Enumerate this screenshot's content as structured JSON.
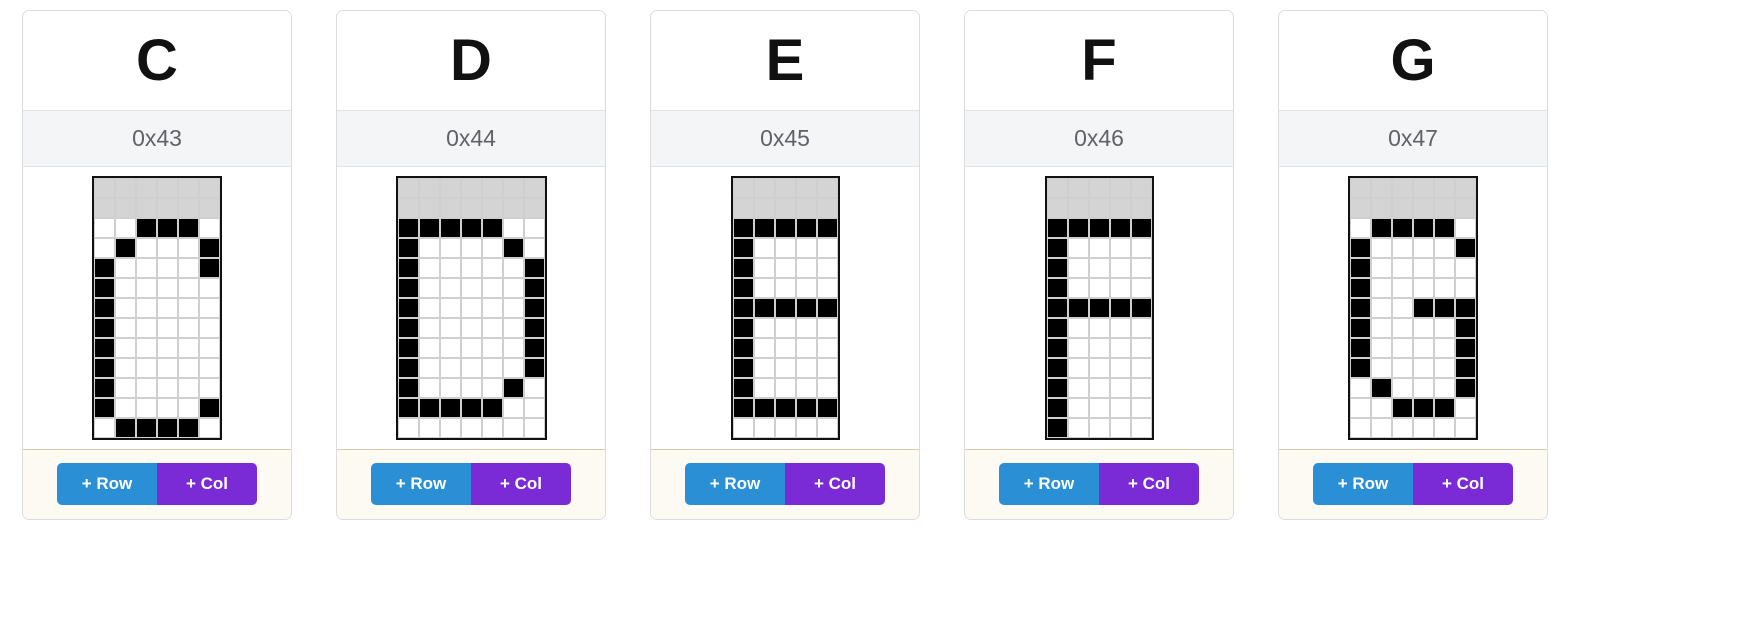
{
  "app": {
    "background": "#ffffff",
    "card_border": "#dcdcdc",
    "code_bar_bg": "#f4f5f7",
    "actions_bg": "#fdfaf3",
    "actions_border": "#dcc9a8",
    "pixel_on_color": "#000000",
    "pixel_off_color": "#ffffff",
    "pixel_ascender_color": "#d4d4d4",
    "grid_border_color": "#111111",
    "add_row_color": "#2b8fd6",
    "add_col_color": "#7a2bd6"
  },
  "buttons": {
    "add_row_label": "+ Row",
    "add_col_label": "+ Col"
  },
  "cards": [
    {
      "char": "C",
      "code": "0x43",
      "cols": 6,
      "rows": 13,
      "ascender_rows": 2,
      "pixels": [
        [
          0,
          0,
          0,
          0,
          0,
          0
        ],
        [
          0,
          0,
          0,
          0,
          0,
          0
        ],
        [
          0,
          0,
          1,
          1,
          1,
          0
        ],
        [
          0,
          1,
          0,
          0,
          0,
          1
        ],
        [
          1,
          0,
          0,
          0,
          0,
          1
        ],
        [
          1,
          0,
          0,
          0,
          0,
          0
        ],
        [
          1,
          0,
          0,
          0,
          0,
          0
        ],
        [
          1,
          0,
          0,
          0,
          0,
          0
        ],
        [
          1,
          0,
          0,
          0,
          0,
          0
        ],
        [
          1,
          0,
          0,
          0,
          0,
          0
        ],
        [
          1,
          0,
          0,
          0,
          0,
          0
        ],
        [
          1,
          0,
          0,
          0,
          0,
          1
        ],
        [
          0,
          1,
          1,
          1,
          1,
          0
        ]
      ]
    },
    {
      "char": "D",
      "code": "0x44",
      "cols": 7,
      "rows": 13,
      "ascender_rows": 2,
      "pixels": [
        [
          0,
          0,
          0,
          0,
          0,
          0,
          0
        ],
        [
          0,
          0,
          0,
          0,
          0,
          0,
          0
        ],
        [
          1,
          1,
          1,
          1,
          1,
          0,
          0
        ],
        [
          1,
          0,
          0,
          0,
          0,
          1,
          0
        ],
        [
          1,
          0,
          0,
          0,
          0,
          0,
          1
        ],
        [
          1,
          0,
          0,
          0,
          0,
          0,
          1
        ],
        [
          1,
          0,
          0,
          0,
          0,
          0,
          1
        ],
        [
          1,
          0,
          0,
          0,
          0,
          0,
          1
        ],
        [
          1,
          0,
          0,
          0,
          0,
          0,
          1
        ],
        [
          1,
          0,
          0,
          0,
          0,
          0,
          1
        ],
        [
          1,
          0,
          0,
          0,
          0,
          1,
          0
        ],
        [
          1,
          1,
          1,
          1,
          1,
          0,
          0
        ],
        [
          0,
          0,
          0,
          0,
          0,
          0,
          0
        ]
      ]
    },
    {
      "char": "E",
      "code": "0x45",
      "cols": 5,
      "rows": 13,
      "ascender_rows": 2,
      "pixels": [
        [
          0,
          0,
          0,
          0,
          0
        ],
        [
          0,
          0,
          0,
          0,
          0
        ],
        [
          1,
          1,
          1,
          1,
          1
        ],
        [
          1,
          0,
          0,
          0,
          0
        ],
        [
          1,
          0,
          0,
          0,
          0
        ],
        [
          1,
          0,
          0,
          0,
          0
        ],
        [
          1,
          1,
          1,
          1,
          1
        ],
        [
          1,
          0,
          0,
          0,
          0
        ],
        [
          1,
          0,
          0,
          0,
          0
        ],
        [
          1,
          0,
          0,
          0,
          0
        ],
        [
          1,
          0,
          0,
          0,
          0
        ],
        [
          1,
          1,
          1,
          1,
          1
        ],
        [
          0,
          0,
          0,
          0,
          0
        ]
      ]
    },
    {
      "char": "F",
      "code": "0x46",
      "cols": 5,
      "rows": 13,
      "ascender_rows": 2,
      "pixels": [
        [
          0,
          0,
          0,
          0,
          0
        ],
        [
          0,
          0,
          0,
          0,
          0
        ],
        [
          1,
          1,
          1,
          1,
          1
        ],
        [
          1,
          0,
          0,
          0,
          0
        ],
        [
          1,
          0,
          0,
          0,
          0
        ],
        [
          1,
          0,
          0,
          0,
          0
        ],
        [
          1,
          1,
          1,
          1,
          1
        ],
        [
          1,
          0,
          0,
          0,
          0
        ],
        [
          1,
          0,
          0,
          0,
          0
        ],
        [
          1,
          0,
          0,
          0,
          0
        ],
        [
          1,
          0,
          0,
          0,
          0
        ],
        [
          1,
          0,
          0,
          0,
          0
        ],
        [
          1,
          0,
          0,
          0,
          0
        ]
      ]
    },
    {
      "char": "G",
      "code": "0x47",
      "cols": 6,
      "rows": 13,
      "ascender_rows": 2,
      "pixels": [
        [
          0,
          0,
          0,
          0,
          0,
          0
        ],
        [
          0,
          0,
          0,
          0,
          0,
          0
        ],
        [
          0,
          1,
          1,
          1,
          1,
          0
        ],
        [
          1,
          0,
          0,
          0,
          0,
          1
        ],
        [
          1,
          0,
          0,
          0,
          0,
          0
        ],
        [
          1,
          0,
          0,
          0,
          0,
          0
        ],
        [
          1,
          0,
          0,
          1,
          1,
          1
        ],
        [
          1,
          0,
          0,
          0,
          0,
          1
        ],
        [
          1,
          0,
          0,
          0,
          0,
          1
        ],
        [
          1,
          0,
          0,
          0,
          0,
          1
        ],
        [
          0,
          1,
          0,
          0,
          0,
          1
        ],
        [
          0,
          0,
          1,
          1,
          1,
          0
        ],
        [
          0,
          0,
          0,
          0,
          0,
          0
        ]
      ]
    }
  ]
}
